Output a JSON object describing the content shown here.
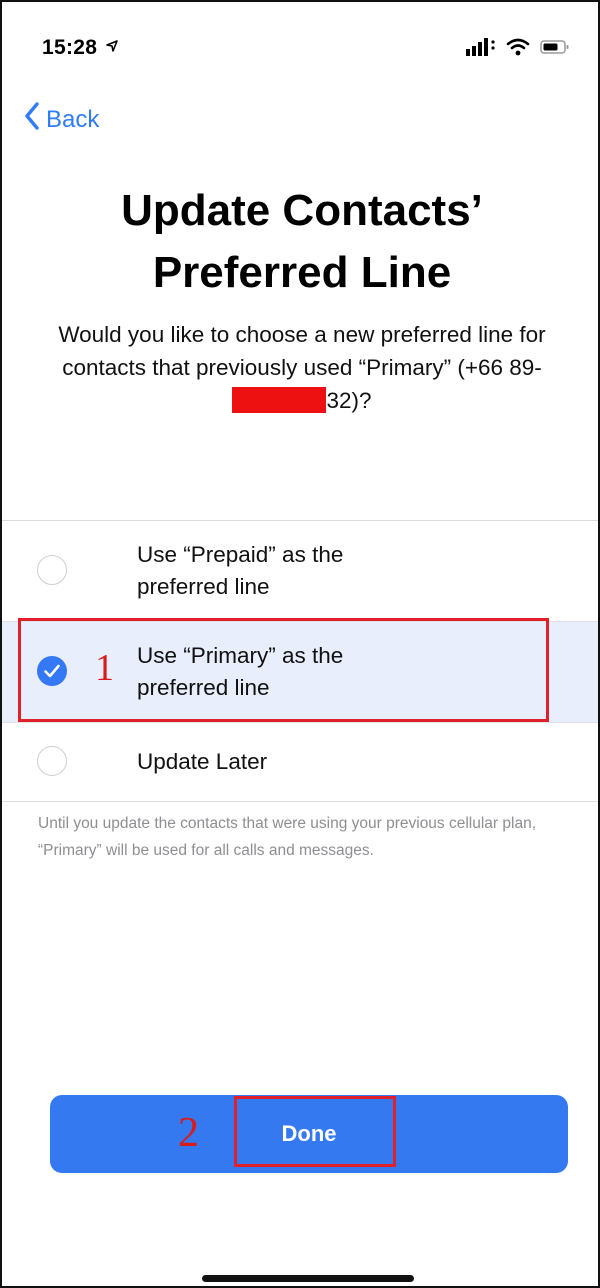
{
  "status_bar": {
    "time": "15:28",
    "location_glyph": "⟡"
  },
  "nav": {
    "back_label": "Back"
  },
  "header": {
    "title_line1": "Update Contacts’",
    "title_line2": "Preferred Line",
    "subtitle_before": "Would you like to choose a new preferred line for contacts that previously used “Primary” (+66 89-",
    "subtitle_after": "32)?"
  },
  "options": [
    {
      "label": "Use “Prepaid” as the preferred line",
      "selected": false
    },
    {
      "label": "Use “Primary” as the preferred line",
      "selected": true
    },
    {
      "label": "Update Later",
      "selected": false
    }
  ],
  "footnote": "Until you update the contacts that were using your previous cellular plan, “Primary” will be used for all calls and messages.",
  "footer": {
    "done_label": "Done"
  },
  "annotations": {
    "step1": "1",
    "step2": "2"
  },
  "colors": {
    "accent": "#3478f6",
    "annotation_red": "#e0202a"
  }
}
